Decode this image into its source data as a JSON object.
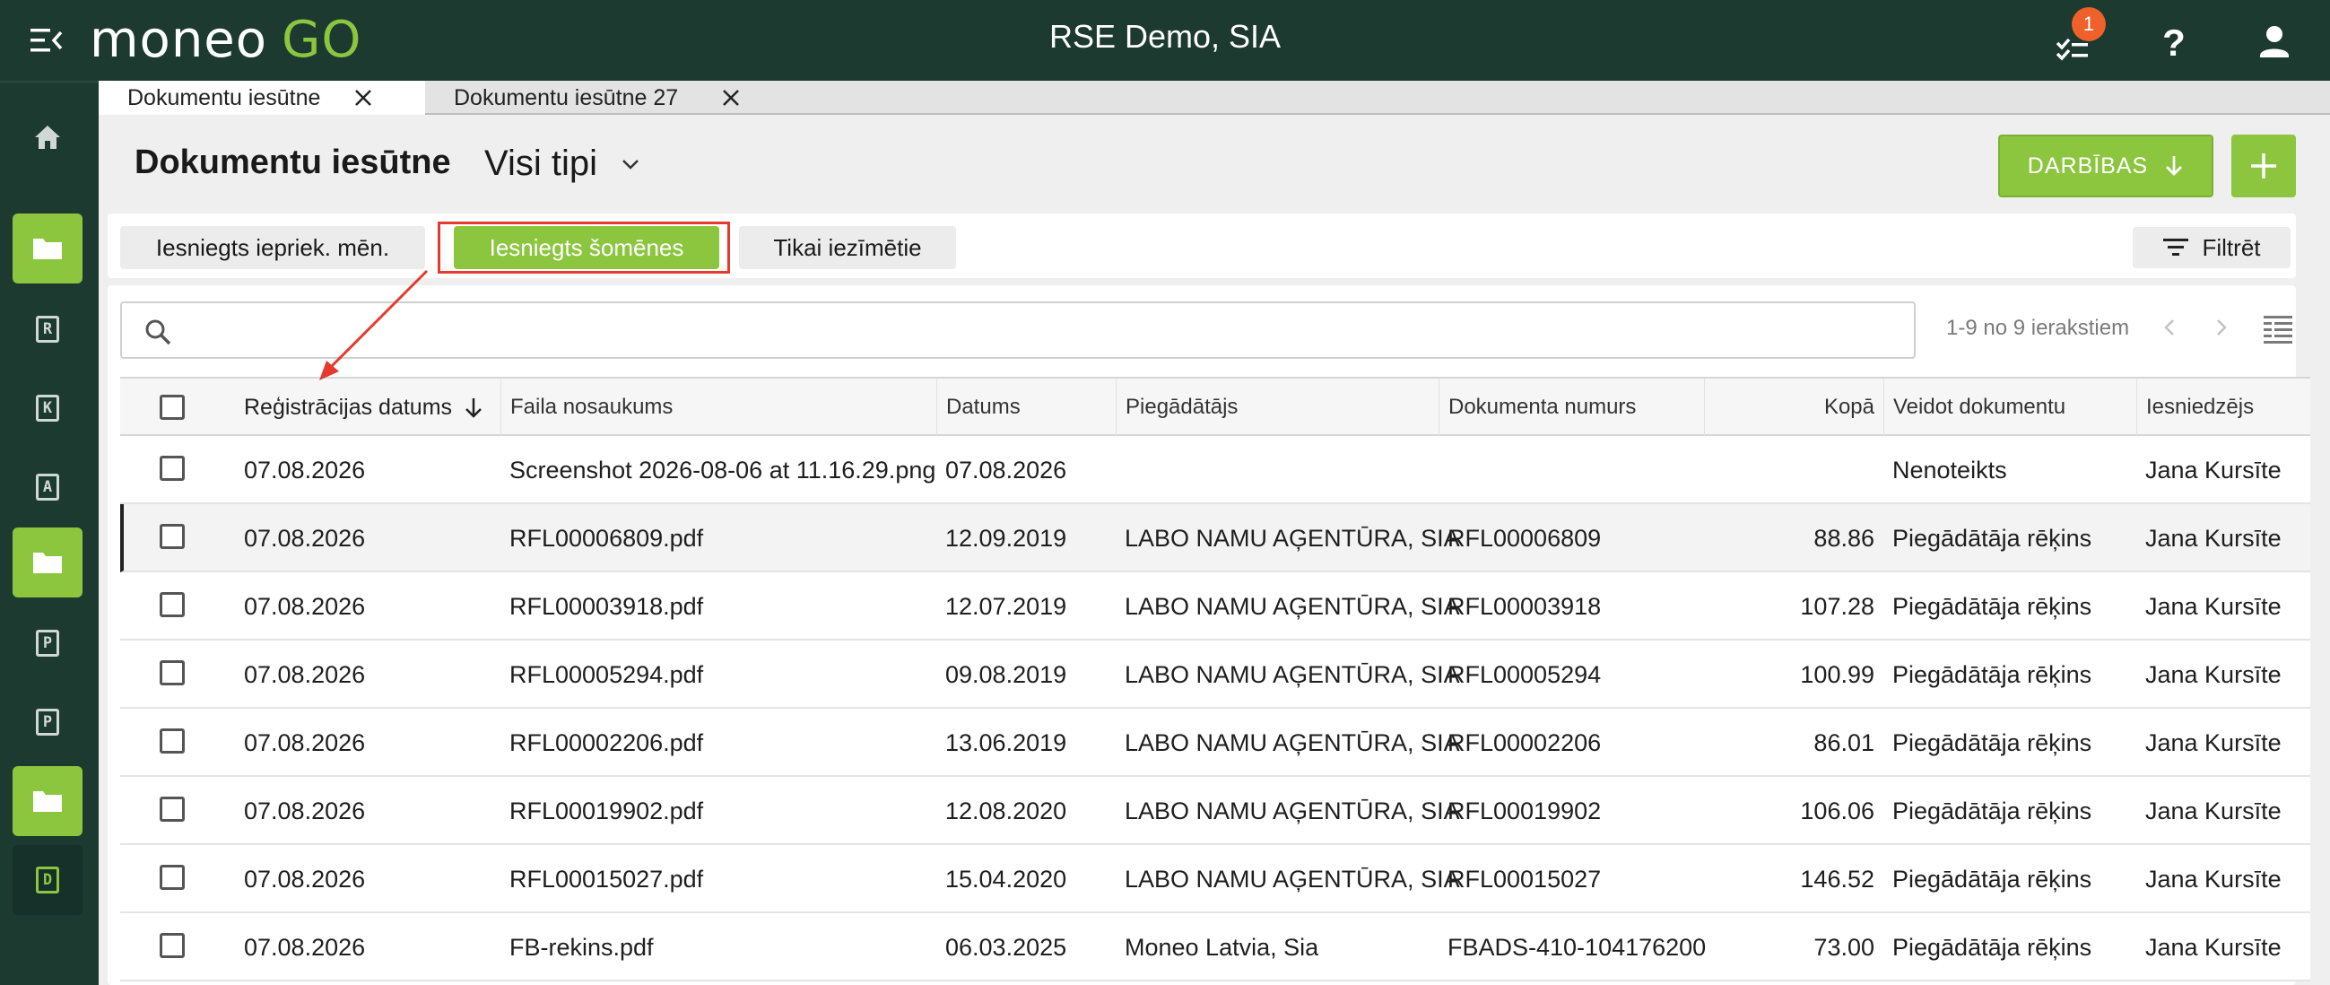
{
  "header": {
    "logo_main": "moneo",
    "logo_accent": "GO",
    "company": "RSE Demo, SIA",
    "notification_count": "1"
  },
  "tabs": [
    {
      "label": "Dokumentu iesūtne"
    },
    {
      "label": "Dokumentu iesūtne 27"
    }
  ],
  "sidebar": {
    "letters": [
      "R",
      "K",
      "A",
      "P",
      "P",
      "D"
    ]
  },
  "page": {
    "title": "Dokumentu iesūtne",
    "type_selector": "Visi tipi",
    "actions_label": "DARBĪBAS"
  },
  "filters": {
    "chips": [
      "Iesniegts iepriek. mēn.",
      "Iesniegts šomēnes",
      "Tikai iezīmētie"
    ],
    "filter_button": "Filtrēt"
  },
  "search": {
    "placeholder": ""
  },
  "pager": {
    "text": "1-9 no 9 ierakstiem"
  },
  "table": {
    "columns": [
      "Reģistrācijas datums",
      "Faila nosaukums",
      "Datums",
      "Piegādātājs",
      "Dokumenta numurs",
      "Kopā",
      "Veidot dokumentu",
      "Iesniedzējs"
    ],
    "rows": [
      [
        "07.08.2026",
        "Screenshot 2026-08-06 at 11.16.29.png",
        "07.08.2026",
        "",
        "",
        "",
        "Nenoteikts",
        "Jana Kursīte"
      ],
      [
        "07.08.2026",
        "RFL00006809.pdf",
        "12.09.2019",
        "LABO NAMU AĢENTŪRA, SIA",
        "RFL00006809",
        "88.86",
        "Piegādātāja rēķins",
        "Jana Kursīte"
      ],
      [
        "07.08.2026",
        "RFL00003918.pdf",
        "12.07.2019",
        "LABO NAMU AĢENTŪRA, SIA",
        "RFL00003918",
        "107.28",
        "Piegādātāja rēķins",
        "Jana Kursīte"
      ],
      [
        "07.08.2026",
        "RFL00005294.pdf",
        "09.08.2019",
        "LABO NAMU AĢENTŪRA, SIA",
        "RFL00005294",
        "100.99",
        "Piegādātāja rēķins",
        "Jana Kursīte"
      ],
      [
        "07.08.2026",
        "RFL00002206.pdf",
        "13.06.2019",
        "LABO NAMU AĢENTŪRA, SIA",
        "RFL00002206",
        "86.01",
        "Piegādātāja rēķins",
        "Jana Kursīte"
      ],
      [
        "07.08.2026",
        "RFL00019902.pdf",
        "12.08.2020",
        "LABO NAMU AĢENTŪRA, SIA",
        "RFL00019902",
        "106.06",
        "Piegādātāja rēķins",
        "Jana Kursīte"
      ],
      [
        "07.08.2026",
        "RFL00015027.pdf",
        "15.04.2020",
        "LABO NAMU AĢENTŪRA, SIA",
        "RFL00015027",
        "146.52",
        "Piegādātāja rēķins",
        "Jana Kursīte"
      ],
      [
        "07.08.2026",
        "FB-rekins.pdf",
        "06.03.2025",
        "Moneo Latvia, Sia",
        "FBADS-410-104176200",
        "73.00",
        "Piegādātāja rēķins",
        "Jana Kursīte"
      ]
    ]
  },
  "colors": {
    "brand_dark": "#1d3a30",
    "accent_green": "#8cc63f",
    "highlight_red": "#e53a2e",
    "badge_orange": "#f0602a"
  }
}
